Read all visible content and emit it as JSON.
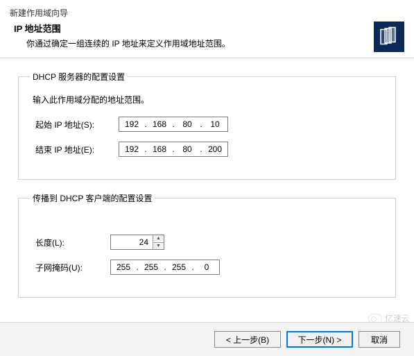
{
  "wizardTitle": "新建作用域向导",
  "header": {
    "title": "IP 地址范围",
    "desc": "你通过确定一组连续的 IP 地址来定义作用域地址范围。"
  },
  "group1": {
    "legend": "DHCP 服务器的配置设置",
    "desc": "输入此作用域分配的地址范围。",
    "startLabel": "起始 IP 地址(S):",
    "startIp": {
      "o1": "192",
      "o2": "168",
      "o3": "80",
      "o4": "10"
    },
    "endLabel": "结束 IP 地址(E):",
    "endIp": {
      "o1": "192",
      "o2": "168",
      "o3": "80",
      "o4": "200"
    }
  },
  "group2": {
    "legend": "传播到 DHCP 客户端的配置设置",
    "lengthLabel": "长度(L):",
    "lengthValue": "24",
    "maskLabel": "子网掩码(U):",
    "mask": {
      "o1": "255",
      "o2": "255",
      "o3": "255",
      "o4": "0"
    }
  },
  "buttons": {
    "back": "< 上一步(B)",
    "next": "下一步(N) >",
    "cancel": "取消"
  },
  "watermark": "亿速云"
}
